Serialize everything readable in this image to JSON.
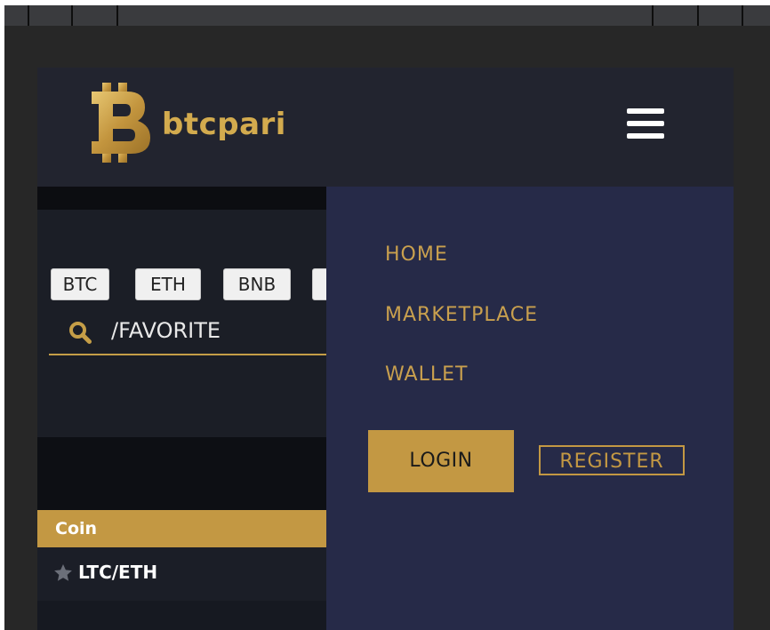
{
  "brand": {
    "name": "btcpari",
    "gold": "#C39843",
    "menu_bg": "#262A48"
  },
  "header": {
    "menu_icon": "hamburger-icon"
  },
  "markets": {
    "tabs": [
      {
        "label": "BTC"
      },
      {
        "label": "ETH"
      },
      {
        "label": "BNB"
      },
      {
        "label": ""
      }
    ]
  },
  "search": {
    "value": "/FAVORITE",
    "icon": "search-icon"
  },
  "table": {
    "column_header": "Coin",
    "rows": [
      {
        "pair": "LTC/ETH",
        "icon": "star-icon"
      }
    ]
  },
  "menu": {
    "items": [
      {
        "label": "HOME"
      },
      {
        "label": "MARKETPLACE"
      },
      {
        "label": "WALLET"
      }
    ],
    "login_label": "LOGIN",
    "register_label": "REGISTER"
  }
}
